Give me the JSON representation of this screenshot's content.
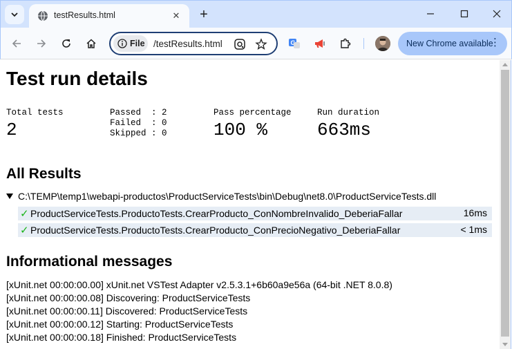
{
  "browser": {
    "tab_title": "testResults.html",
    "url": "/testResults.html",
    "file_chip": "File",
    "update_label": "New Chrome available"
  },
  "page": {
    "title": "Test run details",
    "summary": {
      "total_label": "Total tests",
      "total_value": "2",
      "passed_line": "Passed  : 2",
      "failed_line": "Failed  : 0",
      "skipped_line": "Skipped : 0",
      "pass_label": "Pass percentage",
      "pass_value": "100 %",
      "duration_label": "Run duration",
      "duration_value": "663ms"
    },
    "all_results_heading": "All Results",
    "assembly": "C:\\TEMP\\temp1\\webapi-productos\\ProductServiceTests\\bin\\Debug\\net8.0\\ProductServiceTests.dll",
    "tests": [
      {
        "name": "ProductServiceTests.ProductoTests.CrearProducto_ConNombreInvalido_DeberiaFallar",
        "duration": "16ms",
        "status": "passed"
      },
      {
        "name": "ProductServiceTests.ProductoTests.CrearProducto_ConPrecioNegativo_DeberiaFallar",
        "duration": "< 1ms",
        "status": "passed"
      }
    ],
    "messages_heading": "Informational messages",
    "messages": [
      "[xUnit.net 00:00:00.00] xUnit.net VSTest Adapter v2.5.3.1+6b60a9e56a (64-bit .NET 8.0.8)",
      "[xUnit.net 00:00:00.08] Discovering: ProductServiceTests",
      "[xUnit.net 00:00:00.11] Discovered: ProductServiceTests",
      "[xUnit.net 00:00:00.12] Starting: ProductServiceTests",
      "[xUnit.net 00:00:00.18] Finished: ProductServiceTests"
    ]
  },
  "colors": {
    "pass_check": "#18b318",
    "row_background": "#e6edf5",
    "chrome_frame": "#d3e3fd"
  }
}
